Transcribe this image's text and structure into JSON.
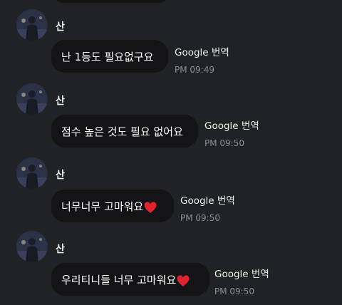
{
  "messages": [
    {
      "sender": "산",
      "text": "난 1등도 필요없구요",
      "translate": "Google 번역",
      "time": "PM 09:49",
      "heart": false
    },
    {
      "sender": "산",
      "text": "점수 높은 것도 필요 없어요",
      "translate": "Google 번역",
      "time": "PM 09:50",
      "heart": false
    },
    {
      "sender": "산",
      "text": "너무너무 고마워요",
      "translate": "Google 번역",
      "time": "PM 09:50",
      "heart": true
    },
    {
      "sender": "산",
      "text": "우리티니들 너무 고마워요",
      "translate": "Google 번역",
      "time": "PM 09:50",
      "heart": true
    }
  ],
  "colors": {
    "background": "#202226",
    "bubble": "#141416",
    "heart": "#e0242f",
    "time": "#8b8e94"
  },
  "icons": {
    "heart": "red-heart-emoji",
    "avatar": "profile-photo"
  }
}
